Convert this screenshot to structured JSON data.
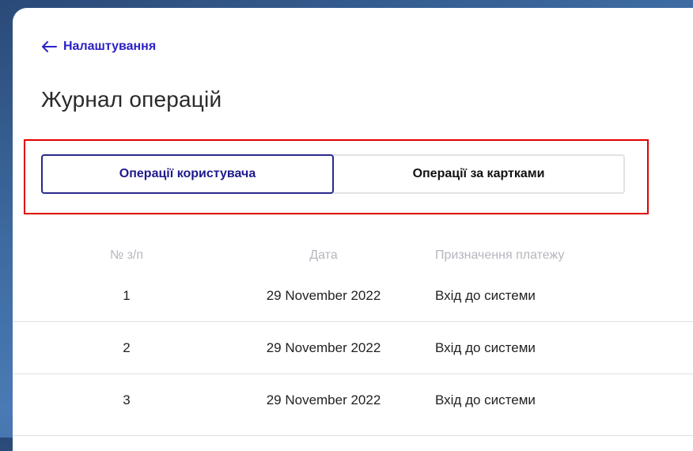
{
  "header": {
    "back_label": "Налаштування",
    "title": "Журнал операцій"
  },
  "tabs": [
    {
      "label": "Операції користувача",
      "active": true
    },
    {
      "label": "Операції за картками",
      "active": false
    }
  ],
  "table": {
    "columns": [
      "№ з/п",
      "Дата",
      "Призначення платежу"
    ],
    "rows": [
      {
        "num": "1",
        "date": "29 November 2022",
        "purpose": "Вхід до системи"
      },
      {
        "num": "2",
        "date": "29 November 2022",
        "purpose": "Вхід до системи"
      },
      {
        "num": "3",
        "date": "29 November 2022",
        "purpose": "Вхід до системи"
      }
    ]
  },
  "colors": {
    "accent": "#2b22c7",
    "active_tab_border": "#2a2a8c",
    "highlight": "#e00000"
  }
}
